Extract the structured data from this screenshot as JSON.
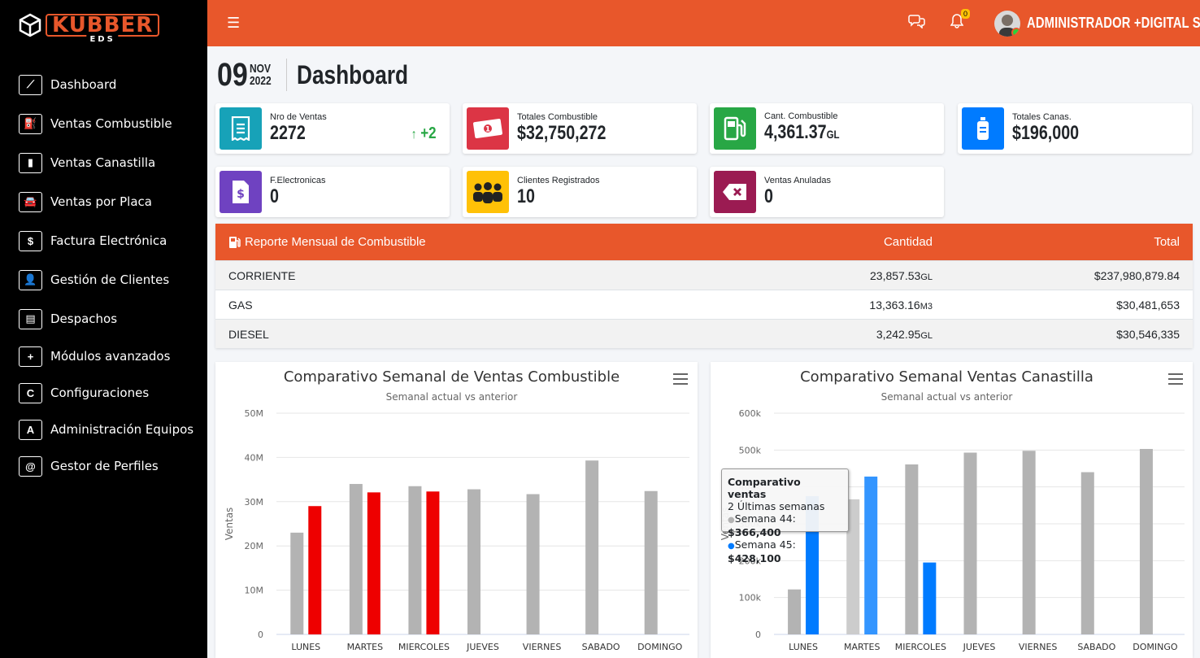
{
  "brand": {
    "name": "KUBBER",
    "sub": "EDS"
  },
  "sidebar": {
    "items": [
      {
        "label": "Dashboard",
        "icon": "chart-line-icon",
        "glyph": "⟋"
      },
      {
        "label": "Ventas Combustible",
        "icon": "gas-pump-icon",
        "glyph": "⛽"
      },
      {
        "label": "Ventas Canastilla",
        "icon": "bottle-icon",
        "glyph": "▮"
      },
      {
        "label": "Ventas por Placa",
        "icon": "car-icon",
        "glyph": "🚘"
      },
      {
        "label": "Factura Electrónica",
        "icon": "invoice-icon",
        "glyph": "$"
      },
      {
        "label": "Gestión de Clientes",
        "icon": "user-icon",
        "glyph": "👤"
      },
      {
        "label": "Despachos",
        "icon": "clipboard-icon",
        "glyph": "▤"
      },
      {
        "label": "Módulos avanzados",
        "icon": "plus-icon",
        "glyph": "+"
      },
      {
        "label": "Configuraciones",
        "icon": "letter-c-icon",
        "glyph": "C"
      },
      {
        "label": "Administración Equipos",
        "icon": "letter-a-icon",
        "glyph": "A"
      },
      {
        "label": "Gestor de Perfiles",
        "icon": "at-icon",
        "glyph": "@"
      }
    ]
  },
  "topbar": {
    "notifications_count": "0",
    "user": "ADMINISTRADOR +DIGITAL SAS"
  },
  "header": {
    "day": "09",
    "month": "NOV",
    "year": "2022",
    "title": "Dashboard"
  },
  "cards": [
    {
      "label": "Nro de Ventas",
      "value": "2272",
      "delta": "+2",
      "color": "#17a2b8"
    },
    {
      "label": "Totales Combustible",
      "value": "$32,750,272",
      "color": "#dc3545"
    },
    {
      "label": "Cant. Combustible",
      "value": "4,361.37",
      "unit": "GL",
      "color": "#28a745"
    },
    {
      "label": "Totales Canas.",
      "value": "$196,000",
      "color": "#007bff"
    },
    {
      "label": "F.Electronicas",
      "value": "0",
      "color": "#6f42c1"
    },
    {
      "label": "Clientes Registrados",
      "value": "10",
      "color": "#ffc107"
    },
    {
      "label": "Ventas Anuladas",
      "value": "0",
      "color": "#9b1b52"
    }
  ],
  "report": {
    "title": "Reporte Mensual de Combustible",
    "col_qty": "Cantidad",
    "col_total": "Total",
    "rows": [
      {
        "name": "CORRIENTE",
        "qty": "23,857.53",
        "unit": "GL",
        "total": "$237,980,879.84"
      },
      {
        "name": "GAS",
        "qty": "13,363.16",
        "unit": "M3",
        "total": "$30,481,653"
      },
      {
        "name": "DIESEL",
        "qty": "3,242.95",
        "unit": "GL",
        "total": "$30,546,335"
      }
    ]
  },
  "chart_data": [
    {
      "type": "bar",
      "title": "Comparativo Semanal de Ventas Combustible",
      "subtitle": "Semanal actual vs anterior",
      "ylabel": "Ventas",
      "categories": [
        "LUNES",
        "MARTES",
        "MIERCOLES",
        "JUEVES",
        "VIERNES",
        "SABADO",
        "DOMINGO"
      ],
      "ylim": [
        0,
        50000000
      ],
      "yticks": [
        0,
        10000000,
        20000000,
        30000000,
        40000000,
        50000000
      ],
      "ytick_labels": [
        "0",
        "10M",
        "20M",
        "30M",
        "40M",
        "50M"
      ],
      "series": [
        {
          "values": [
            23000000,
            34000000,
            33500000,
            32800000,
            31700000,
            39300000,
            32400000
          ],
          "color": "#b3b3b3"
        },
        {
          "values": [
            29000000,
            32100000,
            32300000,
            null,
            null,
            null,
            null
          ],
          "color": "#ee0000"
        }
      ]
    },
    {
      "type": "bar",
      "title": "Comparativo Semanal Ventas Canastilla",
      "subtitle": "Semanal actual vs anterior",
      "ylabel": "Ventas",
      "categories": [
        "LUNES",
        "MARTES",
        "MIERCOLES",
        "JUEVES",
        "VIERNES",
        "SABADO",
        "DOMINGO"
      ],
      "ylim": [
        0,
        600000
      ],
      "yticks": [
        0,
        100000,
        200000,
        300000,
        400000,
        500000,
        600000
      ],
      "ytick_labels": [
        "0",
        "100k",
        "200k",
        "300k",
        "400k",
        "500k",
        "600k"
      ],
      "series": [
        {
          "name": "Semana 44",
          "values": [
            122000,
            366400,
            461000,
            493000,
            498000,
            440000,
            503000
          ],
          "color": "#b3b3b3"
        },
        {
          "name": "Semana 45",
          "values": [
            375000,
            428100,
            195000,
            null,
            null,
            null,
            null
          ],
          "color": "#007bff"
        }
      ],
      "tooltip": {
        "title": "Comparativo ventas",
        "subtitle": "2 Últimas semanas",
        "lines": [
          {
            "label": "Semana 44:",
            "value": "$366,400"
          },
          {
            "label": "Semana 45:",
            "value": "$428,100"
          }
        ]
      }
    }
  ]
}
